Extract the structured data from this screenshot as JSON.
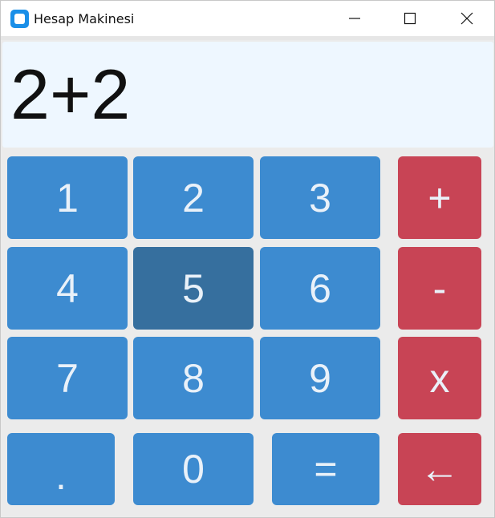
{
  "window": {
    "title": "Hesap Makinesi",
    "controls": {
      "minimize_icon": "minimize-icon",
      "maximize_icon": "maximize-icon",
      "close_icon": "close-icon"
    }
  },
  "display": {
    "value": "2+2"
  },
  "keys": {
    "k1": "1",
    "k2": "2",
    "k3": "3",
    "plus": "+",
    "k4": "4",
    "k5": "5",
    "k6": "6",
    "minus": "-",
    "k7": "7",
    "k8": "8",
    "k9": "9",
    "times": "x",
    "dot": ".",
    "k0": "0",
    "equals": "=",
    "back": "←"
  },
  "colors": {
    "number_key": "#3d8bd0",
    "number_key_hover": "#366f9e",
    "operator_key": "#c84455",
    "display_bg": "#eef7ff",
    "window_bg": "#ebebeb",
    "accent_icon": "#1a8fe8"
  }
}
